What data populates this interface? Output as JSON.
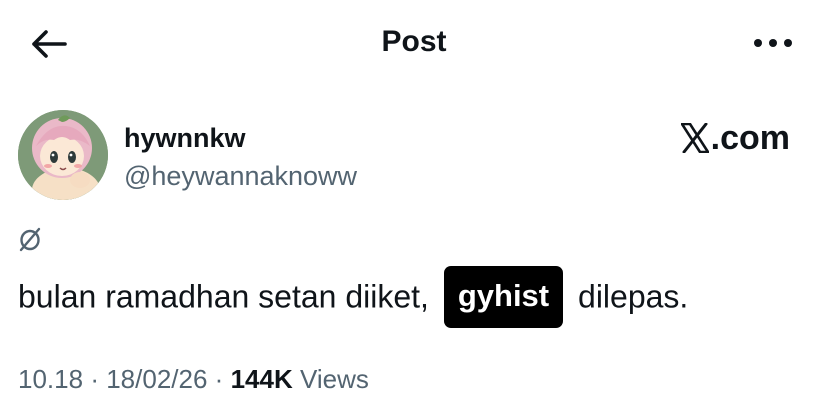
{
  "header": {
    "title": "Post",
    "back_icon": "arrow-left-icon",
    "more_icon": "more-horizontal-icon"
  },
  "author": {
    "display_name": "hywnnkw",
    "handle": "@heywannaknoww"
  },
  "brand": {
    "text": ".com"
  },
  "post": {
    "translate_icon": "translate-icon",
    "text_before": "bulan ramadhan setan diiket,",
    "tag": "gyhist",
    "text_after": "dilepas."
  },
  "meta": {
    "time": "10.18",
    "separator": "·",
    "date": "18/02/26",
    "views_count": "144K",
    "views_label": "Views"
  },
  "colors": {
    "text": "#0f1419",
    "secondary": "#536471",
    "tag_bg": "#000000",
    "tag_text": "#ffffff",
    "background": "#ffffff"
  }
}
